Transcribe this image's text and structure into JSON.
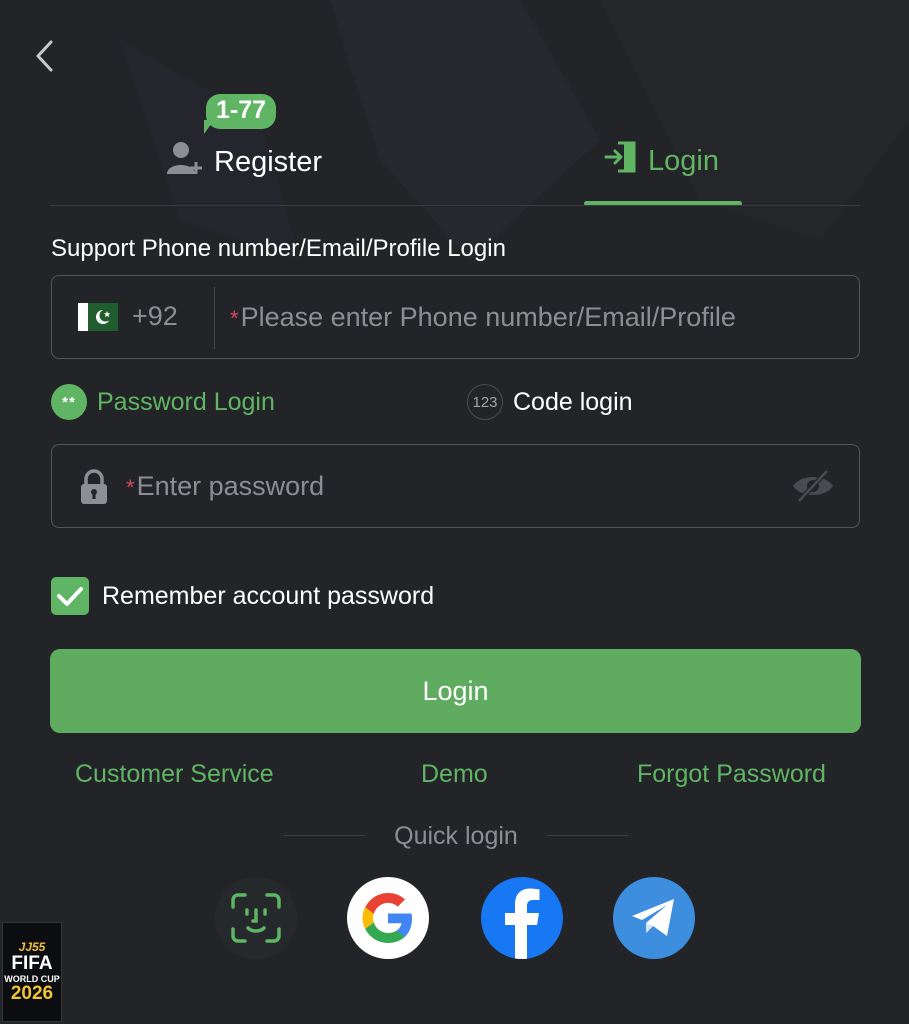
{
  "tabs": {
    "register_label": "Register",
    "register_badge": "1-77",
    "login_label": "Login",
    "active": "Login"
  },
  "support_label": "Support Phone number/Email/Profile Login",
  "phone": {
    "country_code": "+92",
    "flag": "pakistan-flag",
    "required_mark": "*",
    "placeholder": "Please enter Phone number/Email/Profile"
  },
  "login_modes": {
    "password_label": "Password Login",
    "password_icon_text": "**",
    "code_label": "Code login",
    "code_icon_text": "123",
    "selected": "Password Login"
  },
  "password": {
    "required_mark": "*",
    "placeholder": "Enter password"
  },
  "remember": {
    "label": "Remember account password",
    "checked": true
  },
  "login_button": "Login",
  "links": {
    "customer_service": "Customer Service",
    "demo": "Demo",
    "forgot_password": "Forgot Password"
  },
  "quick_login": {
    "label": "Quick login",
    "providers": [
      "face-id-icon",
      "google-icon",
      "facebook-icon",
      "telegram-icon"
    ]
  },
  "promo": {
    "line1": "JJ55",
    "line2": "FIFA",
    "line3": "WORLD CUP",
    "line4": "2026"
  },
  "colors": {
    "background": "#232428",
    "accent": "#5fb563",
    "button": "#5fab60",
    "required": "#d24b5a"
  }
}
